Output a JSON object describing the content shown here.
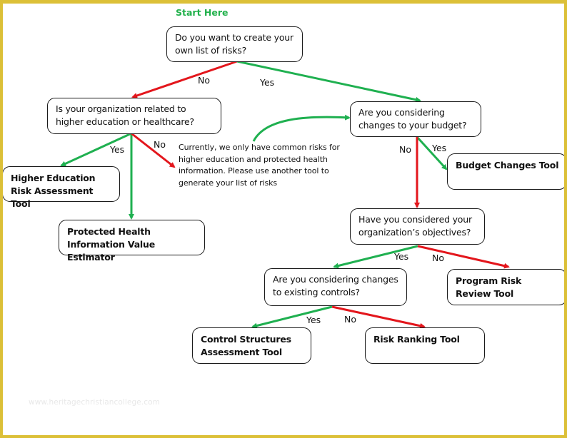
{
  "colors": {
    "yes": "#1fb050",
    "no": "#e3161c",
    "border": "#dcc038",
    "start": "#22b14c"
  },
  "start_label": "Start Here",
  "nodes": {
    "q_create_list": "Do you want to create your own list of risks?",
    "q_higher_ed": "Is your organization related to higher education or healthcare?",
    "q_budget": "Are you considering changes to your budget?",
    "q_objectives": "Have you considered your organization’s objectives?",
    "q_controls": "Are you considering changes to existing controls?",
    "t_higher_ed": "Higher Education Risk Assessment Tool",
    "t_phi": "Protected Health Information Value Estimator",
    "t_budget": "Budget Changes Tool",
    "t_program": "Program Risk Review Tool",
    "t_control": "Control Structures Assessment Tool",
    "t_ranking": "Risk Ranking Tool"
  },
  "note": "Currently, we only have common risks for higher education and protected health information. Please use another tool to generate your list of risks",
  "edge_labels": {
    "create_no": "No",
    "create_yes": "Yes",
    "higher_ed_yes": "Yes",
    "higher_ed_no": "No",
    "budget_no": "No",
    "budget_yes": "Yes",
    "objectives_yes": "Yes",
    "objectives_no": "No",
    "controls_yes": "Yes",
    "controls_no": "No"
  },
  "edges": [
    {
      "from": "q_create_list",
      "to": "q_higher_ed",
      "answer": "No"
    },
    {
      "from": "q_create_list",
      "to": "q_budget",
      "answer": "Yes"
    },
    {
      "from": "q_higher_ed",
      "to": "t_higher_ed",
      "answer": "Yes"
    },
    {
      "from": "q_higher_ed",
      "to": "t_phi",
      "answer": "Yes"
    },
    {
      "from": "q_higher_ed",
      "to": "note",
      "answer": "No"
    },
    {
      "from": "note",
      "to": "q_budget",
      "answer": ""
    },
    {
      "from": "q_budget",
      "to": "t_budget",
      "answer": "Yes"
    },
    {
      "from": "q_budget",
      "to": "q_objectives",
      "answer": "No"
    },
    {
      "from": "q_objectives",
      "to": "q_controls",
      "answer": "Yes"
    },
    {
      "from": "q_objectives",
      "to": "t_program",
      "answer": "No"
    },
    {
      "from": "q_controls",
      "to": "t_control",
      "answer": "Yes"
    },
    {
      "from": "q_controls",
      "to": "t_ranking",
      "answer": "No"
    }
  ],
  "watermark": "www.heritagechristiancollege.com"
}
